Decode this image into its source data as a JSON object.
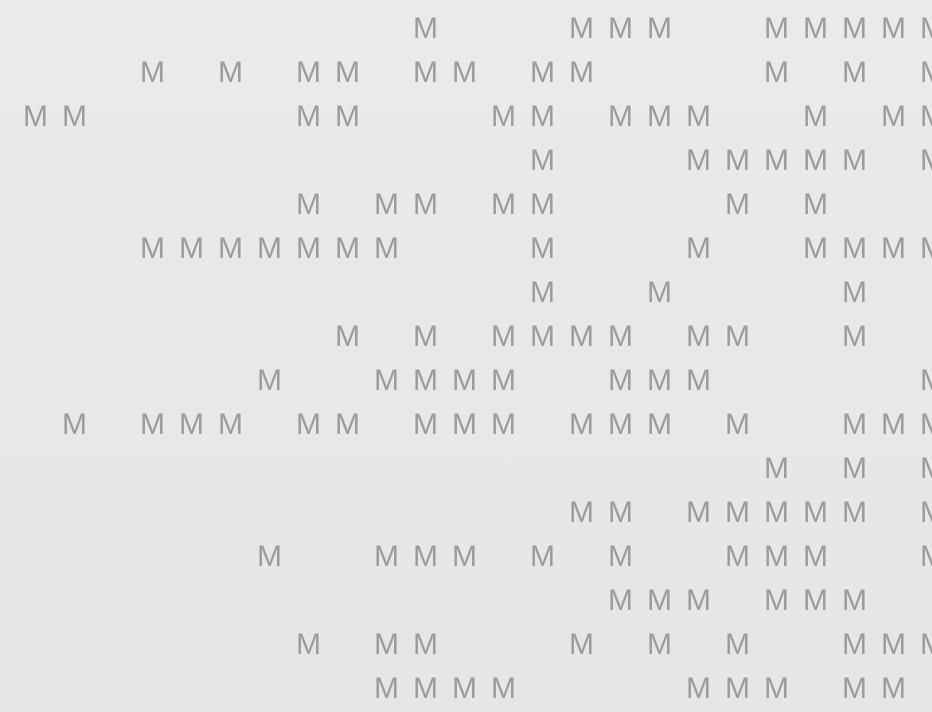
{
  "glyph": "M",
  "colors": {
    "background": "#e9e9e9",
    "glyph": "#9c9c9c"
  },
  "rows": [
    "          M   MMM  MMMMM",
    "   M M MM MM MM    M M M",
    "MM     MM   MM MMM  M MM",
    "             M   MMMMM M",
    "       M MM MM    M M   ",
    "   MMMMMMM   M   M  MMMM",
    "             M  M    M  ",
    "        M M MMMM MM  M  ",
    "      M  MMMM  MMM     M",
    " M MMM MM MMM MMM M  MMM",
    "                   M M M",
    "              MM MMMMM M",
    "      M  MMM M M  MMM  M",
    "               MMM MMM  ",
    "       M MM   M M M  MMM",
    "         MMMM    MMM MM "
  ]
}
